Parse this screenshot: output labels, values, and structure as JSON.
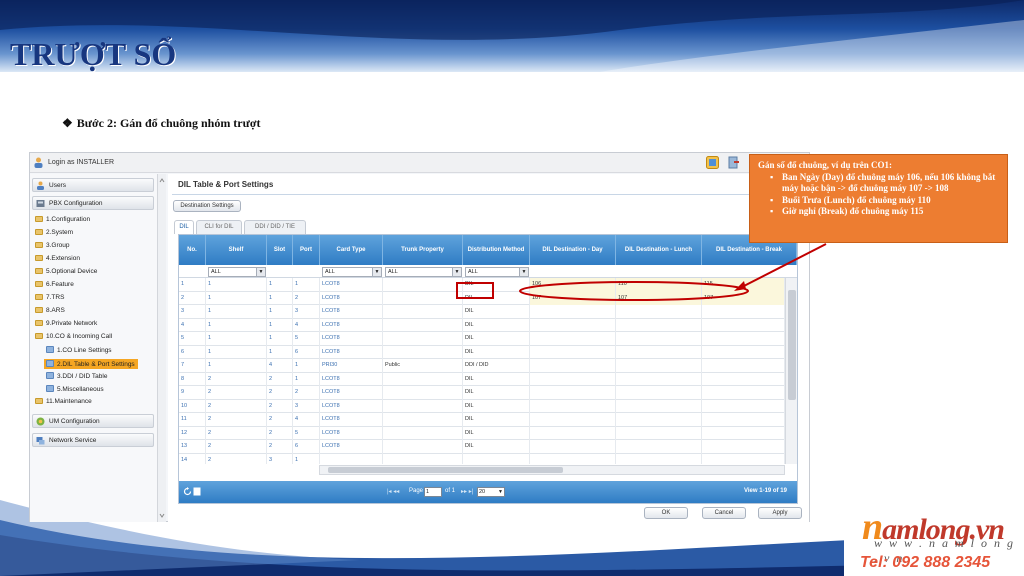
{
  "slide": {
    "title": "TRƯỢT SỔ",
    "step_bullet": "❖",
    "step_text": "Bước 2: Gán đổ chuông nhóm trượt"
  },
  "app": {
    "login_text": "Login as INSTALLER",
    "sidebar": {
      "users": "Users",
      "pbx_configuration": "PBX Configuration",
      "tree": [
        {
          "label": "1.Configuration",
          "type": "folder"
        },
        {
          "label": "2.System",
          "type": "folder"
        },
        {
          "label": "3.Group",
          "type": "folder"
        },
        {
          "label": "4.Extension",
          "type": "folder"
        },
        {
          "label": "5.Optional Device",
          "type": "folder"
        },
        {
          "label": "6.Feature",
          "type": "folder"
        },
        {
          "label": "7.TRS",
          "type": "folder"
        },
        {
          "label": "8.ARS",
          "type": "folder"
        },
        {
          "label": "9.Private Network",
          "type": "folder"
        },
        {
          "label": "10.CO & Incoming Call",
          "type": "folder"
        },
        {
          "label": "1.CO Line Settings",
          "type": "leaf"
        },
        {
          "label": "2.DIL Table & Port Settings",
          "type": "leaf",
          "selected": true
        },
        {
          "label": "3.DDI / DID Table",
          "type": "leaf"
        },
        {
          "label": "5.Miscellaneous",
          "type": "leaf"
        },
        {
          "label": "11.Maintenance",
          "type": "folder"
        }
      ],
      "um_configuration": "UM Configuration",
      "network_service": "Network Service"
    },
    "main": {
      "title": "DIL Table & Port Settings",
      "destination_settings_button": "Destination Settings",
      "tabs": [
        "DIL",
        "CLI for DIL",
        "DDI / DID / TIE"
      ],
      "headers": [
        "No.",
        "Shelf",
        "Slot",
        "Port",
        "Card Type",
        "Trunk Property",
        "Distribution Method",
        "DIL Destination - Day",
        "DIL Destination - Lunch",
        "DIL Destination - Break"
      ],
      "filters": {
        "shelf": "ALL",
        "card_type": "ALL",
        "trunk_property": "ALL",
        "distribution_method": "ALL"
      },
      "rows": [
        [
          "1",
          "1",
          "1",
          "1",
          "LCOT8",
          "",
          "DIL",
          "106",
          "110",
          "115"
        ],
        [
          "2",
          "1",
          "1",
          "2",
          "LCOT8",
          "",
          "DIL",
          "107",
          "107",
          "107"
        ],
        [
          "3",
          "1",
          "1",
          "3",
          "LCOT8",
          "",
          "DIL",
          "",
          "",
          ""
        ],
        [
          "4",
          "1",
          "1",
          "4",
          "LCOT8",
          "",
          "DIL",
          "",
          "",
          ""
        ],
        [
          "5",
          "1",
          "1",
          "5",
          "LCOT8",
          "",
          "DIL",
          "",
          "",
          ""
        ],
        [
          "6",
          "1",
          "1",
          "6",
          "LCOT8",
          "",
          "DIL",
          "",
          "",
          ""
        ],
        [
          "7",
          "1",
          "4",
          "1",
          "PRI30",
          "Public",
          "DDI / DID",
          "",
          "",
          ""
        ],
        [
          "8",
          "2",
          "2",
          "1",
          "LCOT8",
          "",
          "DIL",
          "",
          "",
          ""
        ],
        [
          "9",
          "2",
          "2",
          "2",
          "LCOT8",
          "",
          "DIL",
          "",
          "",
          ""
        ],
        [
          "10",
          "2",
          "2",
          "3",
          "LCOT8",
          "",
          "DIL",
          "",
          "",
          ""
        ],
        [
          "11",
          "2",
          "2",
          "4",
          "LCOT8",
          "",
          "DIL",
          "",
          "",
          ""
        ],
        [
          "12",
          "2",
          "2",
          "5",
          "LCOT8",
          "",
          "DIL",
          "",
          "",
          ""
        ],
        [
          "13",
          "2",
          "2",
          "6",
          "LCOT8",
          "",
          "DIL",
          "",
          "",
          ""
        ],
        [
          "14",
          "2",
          "3",
          "1",
          "",
          "",
          "",
          "",
          "",
          ""
        ]
      ],
      "pager": {
        "page_prefix": "Page",
        "page_value": "1",
        "of_text": "of 1",
        "per_page": "20",
        "view_text": "View 1-19 of 19"
      },
      "buttons": {
        "ok": "OK",
        "cancel": "Cancel",
        "apply": "Apply"
      }
    }
  },
  "callout": {
    "heading": "Gán số đổ chuông, ví dụ trên CO1:",
    "items": [
      "Ban Ngày (Day) đổ chuông máy 106, nếu 106 không bắt máy hoặc bận -> đổ chuông máy 107 -> 108",
      "Buổi Trưa (Lunch) đổ chuông máy 110",
      "Giờ nghỉ (Break) đổ chuông máy 115"
    ]
  },
  "logo": {
    "brand_initial": "n",
    "brand_rest": "amlong.vn",
    "website": "w w w . n a m l o n g . v n",
    "tel": "Tel: 092 888 2345"
  },
  "colors": {
    "callout_bg": "#ed7d31",
    "title_color": "#17367f",
    "grid_header": "#2f7cc4",
    "highlight_red": "#c00000"
  }
}
